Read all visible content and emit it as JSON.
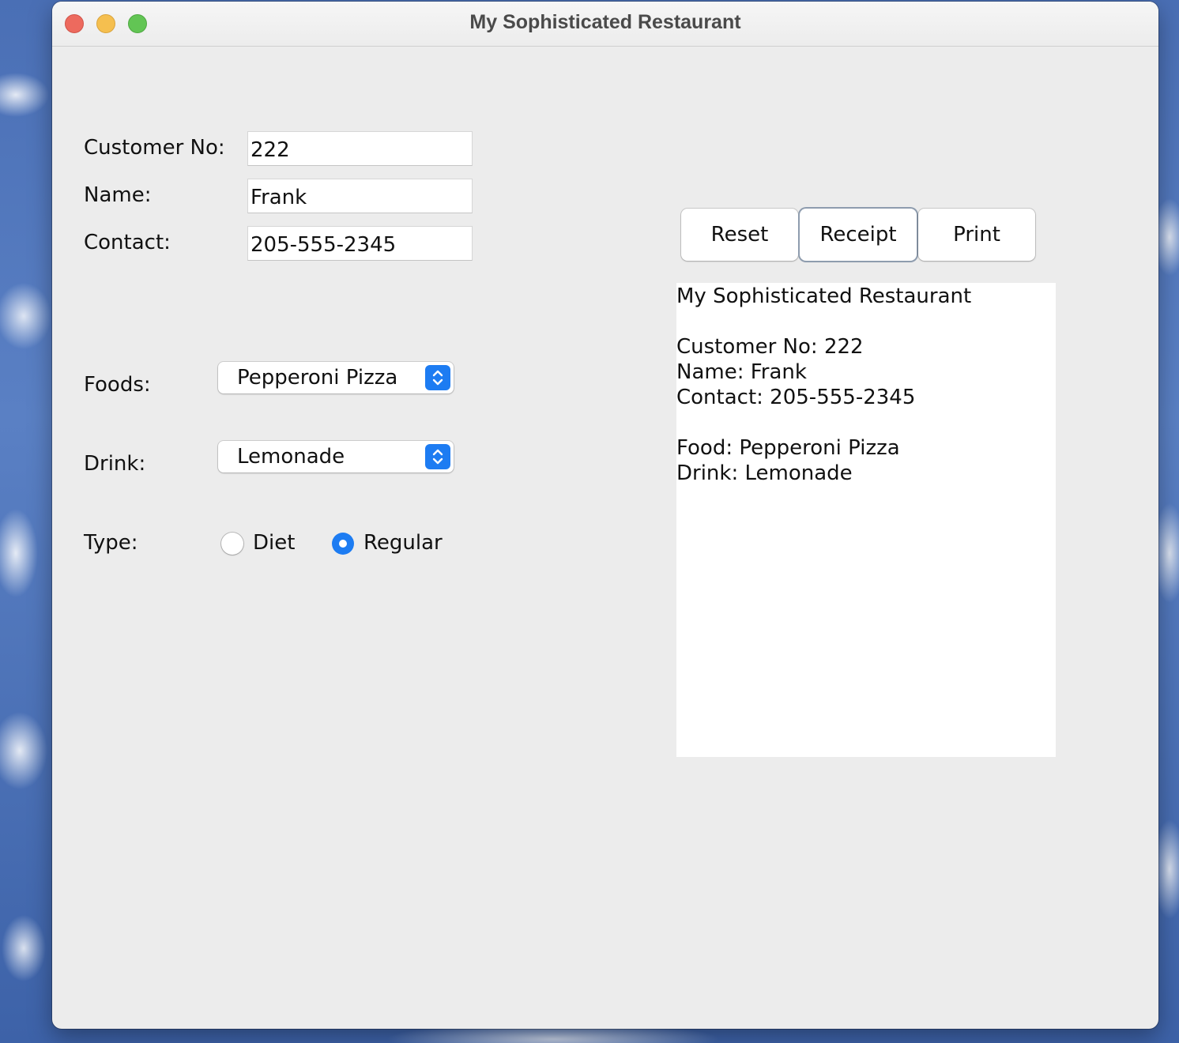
{
  "window": {
    "title": "My Sophisticated Restaurant"
  },
  "form": {
    "customer_no_label": "Customer No:",
    "customer_no_value": "222",
    "name_label": "Name:",
    "name_value": "Frank",
    "contact_label": "Contact:",
    "contact_value": "205-555-2345",
    "foods_label": "Foods:",
    "foods_selected": "Pepperoni Pizza",
    "drink_label": "Drink:",
    "drink_selected": "Lemonade",
    "type_label": "Type:",
    "type_options": [
      {
        "label": "Diet",
        "selected": false
      },
      {
        "label": "Regular",
        "selected": true
      }
    ]
  },
  "buttons": {
    "reset": "Reset",
    "receipt": "Receipt",
    "print": "Print"
  },
  "receipt": {
    "lines": [
      "My Sophisticated Restaurant",
      "",
      "Customer No: 222",
      "Name: Frank",
      "Contact: 205-555-2345",
      "",
      "Food: Pepperoni Pizza",
      "Drink: Lemonade"
    ]
  },
  "colors": {
    "accent": "#1d7cf2",
    "window_bg": "#ececec"
  }
}
